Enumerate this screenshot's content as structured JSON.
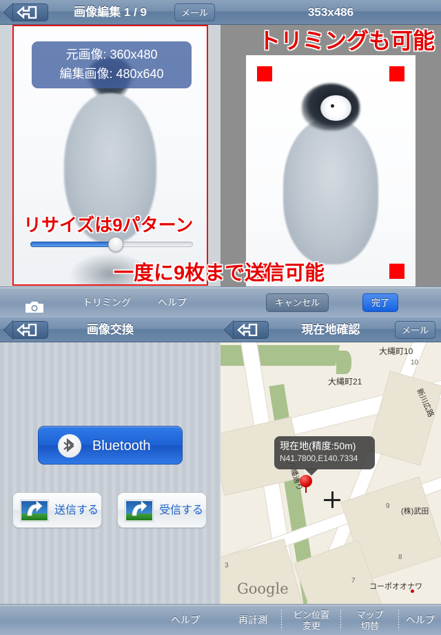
{
  "panels": {
    "image_edit": {
      "nav": {
        "back_icon": "back-arrow-icon",
        "title": "画像編集 1 / 9",
        "mail_button": "メール"
      },
      "overlay_info": {
        "original_label": "元画像: 360x480",
        "edited_label": "編集画像: 480x640"
      },
      "annotations": {
        "resize": "リサイズは9パターン"
      },
      "slider": {
        "value_percent": 55
      },
      "toolbar": {
        "camera_icon": "camera-icon",
        "trim": "トリミング",
        "help": "ヘルプ"
      }
    },
    "crop": {
      "nav": {
        "title": "353x486"
      },
      "annotations": {
        "trim": "トリミングも可能"
      },
      "toolbar": {
        "cancel": "キャンセル",
        "done": "完了"
      }
    },
    "exchange": {
      "nav": {
        "back_icon": "back-arrow-icon",
        "title": "画像交換"
      },
      "bluetooth_button": "Bluetooth",
      "send_button": "送信する",
      "receive_button": "受信する",
      "toolbar": {
        "help": "ヘルプ"
      }
    },
    "location": {
      "nav": {
        "back_icon": "back-arrow-icon",
        "title": "現在地確認",
        "mail_button": "メール"
      },
      "callout": {
        "title": "現在地(精度:50m)",
        "coords": "N41.7800,E140.7334"
      },
      "map_labels": [
        "大縄町10",
        "大縄町21",
        "新川広路",
        "八幡通り",
        "(株)武田",
        "コーポオオナワ"
      ],
      "map_numbers": [
        "10",
        "9",
        "8",
        "7",
        "3"
      ],
      "attribution": "Google",
      "toolbar": {
        "recalc": "再計測",
        "pin_change_l1": "ピン位置",
        "pin_change_l2": "変更",
        "map_switch_l1": "マップ",
        "map_switch_l2": "切替",
        "help": "ヘルプ"
      }
    }
  },
  "shared_annotation": "一度に9枚まで送信可能",
  "colors": {
    "accent_blue": "#1f63d6",
    "annotation_red": "#e60000",
    "nav_blue": "#6d89a8",
    "handle_red": "#ff0000",
    "map_green": "#a9c18c"
  }
}
